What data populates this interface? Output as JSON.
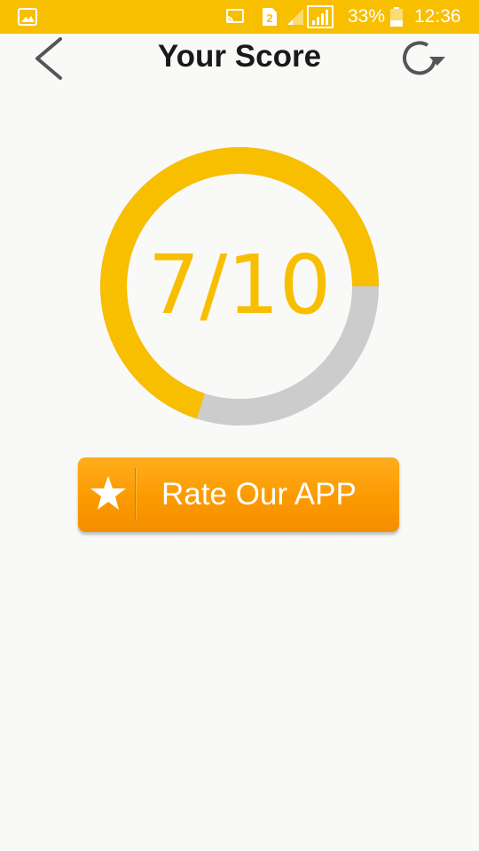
{
  "status_bar": {
    "sim_slot": "2",
    "battery": "33%",
    "time": "12:36",
    "icons": [
      "gallery-icon",
      "cast-icon",
      "sim-icon",
      "signal-icon",
      "battery-icon"
    ]
  },
  "header": {
    "title": "Your Score",
    "back_icon": "chevron-left-icon",
    "refresh_icon": "refresh-icon"
  },
  "score": {
    "text": "7/10",
    "value": 7,
    "max": 10
  },
  "rate_button": {
    "label": "Rate Our APP",
    "icon": "star-icon"
  },
  "colors": {
    "accent": "#f8be00",
    "ring_track": "#cccccc",
    "button": "#fb9a00",
    "background": "#f9f9f7"
  }
}
